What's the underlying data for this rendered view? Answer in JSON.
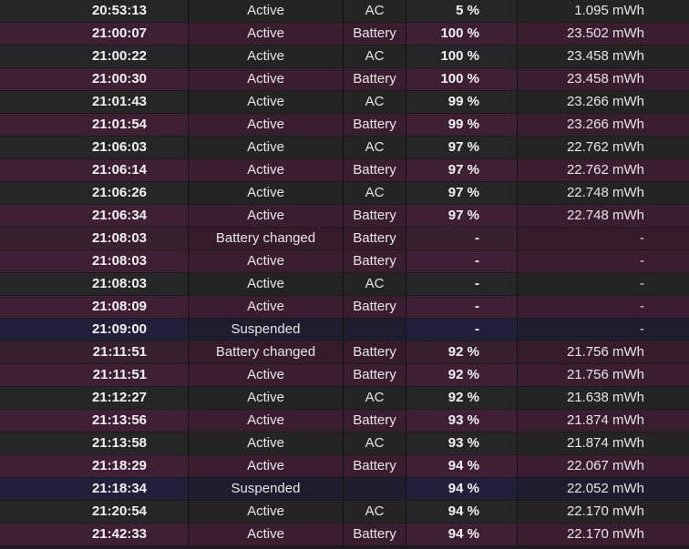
{
  "rows": [
    {
      "time": "20:53:13",
      "state": "Active",
      "source": "AC",
      "percent": "5 %",
      "energy": "1.095 mWh",
      "kind": "active-ac"
    },
    {
      "time": "21:00:07",
      "state": "Active",
      "source": "Battery",
      "percent": "100 %",
      "energy": "23.502 mWh",
      "kind": "active-battery"
    },
    {
      "time": "21:00:22",
      "state": "Active",
      "source": "AC",
      "percent": "100 %",
      "energy": "23.458 mWh",
      "kind": "active-ac"
    },
    {
      "time": "21:00:30",
      "state": "Active",
      "source": "Battery",
      "percent": "100 %",
      "energy": "23.458 mWh",
      "kind": "active-battery"
    },
    {
      "time": "21:01:43",
      "state": "Active",
      "source": "AC",
      "percent": "99 %",
      "energy": "23.266 mWh",
      "kind": "active-ac"
    },
    {
      "time": "21:01:54",
      "state": "Active",
      "source": "Battery",
      "percent": "99 %",
      "energy": "23.266 mWh",
      "kind": "active-battery"
    },
    {
      "time": "21:06:03",
      "state": "Active",
      "source": "AC",
      "percent": "97 %",
      "energy": "22.762 mWh",
      "kind": "active-ac"
    },
    {
      "time": "21:06:14",
      "state": "Active",
      "source": "Battery",
      "percent": "97 %",
      "energy": "22.762 mWh",
      "kind": "active-battery"
    },
    {
      "time": "21:06:26",
      "state": "Active",
      "source": "AC",
      "percent": "97 %",
      "energy": "22.748 mWh",
      "kind": "active-ac"
    },
    {
      "time": "21:06:34",
      "state": "Active",
      "source": "Battery",
      "percent": "97 %",
      "energy": "22.748 mWh",
      "kind": "active-battery"
    },
    {
      "time": "21:08:03",
      "state": "Battery changed",
      "source": "Battery",
      "percent": "-",
      "energy": "-",
      "kind": "battery-changed"
    },
    {
      "time": "21:08:03",
      "state": "Active",
      "source": "Battery",
      "percent": "-",
      "energy": "-",
      "kind": "active-battery"
    },
    {
      "time": "21:08:03",
      "state": "Active",
      "source": "AC",
      "percent": "-",
      "energy": "-",
      "kind": "active-ac"
    },
    {
      "time": "21:08:09",
      "state": "Active",
      "source": "Battery",
      "percent": "-",
      "energy": "-",
      "kind": "active-battery"
    },
    {
      "time": "21:09:00",
      "state": "Suspended",
      "source": "",
      "percent": "-",
      "energy": "-",
      "kind": "suspended"
    },
    {
      "time": "21:11:51",
      "state": "Battery changed",
      "source": "Battery",
      "percent": "92 %",
      "energy": "21.756 mWh",
      "kind": "battery-changed"
    },
    {
      "time": "21:11:51",
      "state": "Active",
      "source": "Battery",
      "percent": "92 %",
      "energy": "21.756 mWh",
      "kind": "active-battery"
    },
    {
      "time": "21:12:27",
      "state": "Active",
      "source": "AC",
      "percent": "92 %",
      "energy": "21.638 mWh",
      "kind": "active-ac"
    },
    {
      "time": "21:13:56",
      "state": "Active",
      "source": "Battery",
      "percent": "93 %",
      "energy": "21.874 mWh",
      "kind": "active-battery"
    },
    {
      "time": "21:13:58",
      "state": "Active",
      "source": "AC",
      "percent": "93 %",
      "energy": "21.874 mWh",
      "kind": "active-ac"
    },
    {
      "time": "21:18:29",
      "state": "Active",
      "source": "Battery",
      "percent": "94 %",
      "energy": "22.067 mWh",
      "kind": "active-battery"
    },
    {
      "time": "21:18:34",
      "state": "Suspended",
      "source": "",
      "percent": "94 %",
      "energy": "22.052 mWh",
      "kind": "suspended"
    },
    {
      "time": "21:20:54",
      "state": "Active",
      "source": "AC",
      "percent": "94 %",
      "energy": "22.170 mWh",
      "kind": "active-ac"
    },
    {
      "time": "21:42:33",
      "state": "Active",
      "source": "Battery",
      "percent": "94 %",
      "energy": "22.170 mWh",
      "kind": "active-battery"
    }
  ]
}
